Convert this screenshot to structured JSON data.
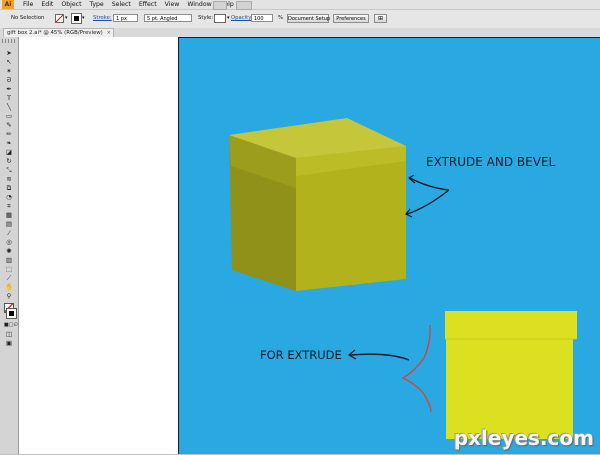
{
  "menubar": {
    "app_icon": "Ai",
    "items": [
      "File",
      "Edit",
      "Object",
      "Type",
      "Select",
      "Effect",
      "View",
      "Window",
      "Help"
    ]
  },
  "control_bar": {
    "selection": "No Selection",
    "stroke_label": "Stroke:",
    "stroke_weight": "1 px",
    "brush_profile": "5 pt. Angled",
    "style_label": "Style:",
    "opacity_label": "Opacity:",
    "opacity_value": "100",
    "opacity_unit": "%",
    "document_setup": "Document Setup",
    "preferences": "Preferences"
  },
  "document": {
    "tab_title": "gift box 2.ai* @ 45% (RGB/Preview)",
    "tab_close": "×"
  },
  "artwork": {
    "label_top": "EXTRUDE AND BEVEL",
    "label_bottom": "FOR EXTRUDE",
    "box_top_color": "#c6c63a",
    "box_front_color": "#b2b21d",
    "box_side_color": "#8f9119",
    "flat_box_color": "#dbe021",
    "artboard_color": "#29a8e1"
  },
  "watermark": "pxleyes.com",
  "colors": {
    "menubar_bg": "#e3e3e3",
    "control_bg": "#e6e6e6",
    "toolbox_bg": "#d4d4d4"
  }
}
